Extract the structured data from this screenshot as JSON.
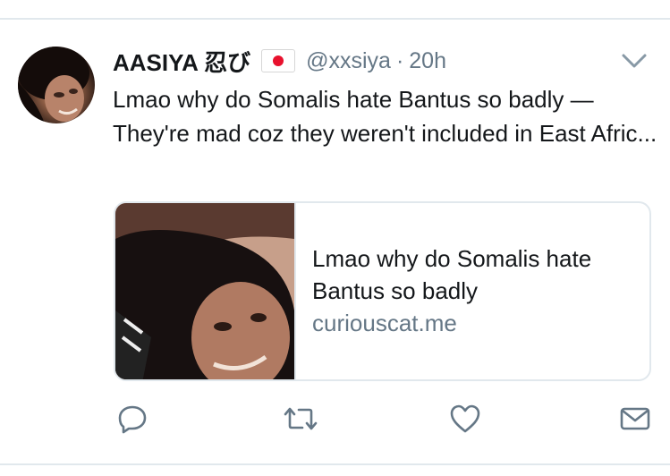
{
  "tweet": {
    "display_name": "AASIYA 忍び",
    "flag": "japan-flag-icon",
    "handle": "@xxsiya",
    "separator": "·",
    "time": "20h",
    "text": "Lmao why do Somalis hate Bantus so badly — They're mad coz they weren't included in East Afric..."
  },
  "card": {
    "title": "Lmao why do Somalis hate Bantus so badly",
    "domain": "curiouscat.me"
  },
  "actions": [
    {
      "name": "reply-icon"
    },
    {
      "name": "retweet-icon"
    },
    {
      "name": "like-icon"
    },
    {
      "name": "direct-message-icon"
    }
  ],
  "colors": {
    "text": "#14171a",
    "secondary": "#657786",
    "border": "#e1e8ed",
    "flag_red": "#e8112d"
  }
}
